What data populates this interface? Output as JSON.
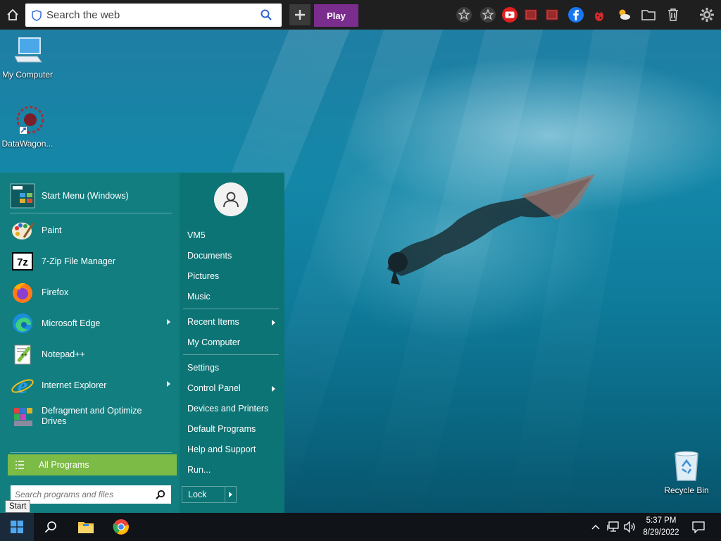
{
  "browser_bar": {
    "search_placeholder": "Search the web",
    "play_label": "Play"
  },
  "desktop": {
    "icons": [
      {
        "label": "My Computer"
      },
      {
        "label": "DataWagon..."
      },
      {
        "label": "Recycle Bin"
      }
    ]
  },
  "start_menu": {
    "pinned": [
      {
        "label": "Start Menu (Windows)"
      },
      {
        "label": "Paint"
      },
      {
        "label": "7-Zip File Manager"
      },
      {
        "label": "Firefox"
      },
      {
        "label": "Microsoft Edge"
      },
      {
        "label": "Notepad++"
      },
      {
        "label": "Internet Explorer"
      },
      {
        "label": "Defragment and Optimize Drives"
      }
    ],
    "all_programs_label": "All Programs",
    "search_placeholder": "Search programs and files",
    "right_items": [
      {
        "label": "VM5"
      },
      {
        "label": "Documents"
      },
      {
        "label": "Pictures"
      },
      {
        "label": "Music"
      },
      {
        "label": "Recent Items"
      },
      {
        "label": "My Computer"
      },
      {
        "label": "Settings"
      },
      {
        "label": "Control Panel"
      },
      {
        "label": "Devices and Printers"
      },
      {
        "label": "Default Programs"
      },
      {
        "label": "Help and Support"
      },
      {
        "label": "Run..."
      }
    ],
    "lock_label": "Lock"
  },
  "tooltip": {
    "text": "Start"
  },
  "taskbar": {
    "time": "5:37 PM",
    "date": "8/29/2022"
  },
  "colors": {
    "menu_bg": "#127e80",
    "all_programs": "#7cbb46",
    "play_button": "#7b2d8e",
    "taskbar": "#101318"
  }
}
